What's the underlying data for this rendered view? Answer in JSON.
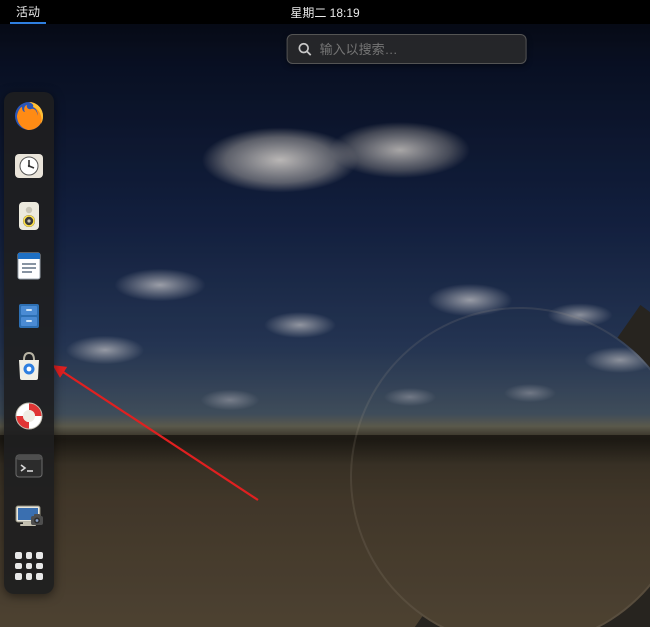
{
  "topbar": {
    "activities_label": "活动",
    "clock": "星期二 18:19"
  },
  "search": {
    "placeholder": "输入以搜索…"
  },
  "dock": {
    "items": [
      {
        "name": "firefox"
      },
      {
        "name": "clock"
      },
      {
        "name": "rhythmbox"
      },
      {
        "name": "libreoffice-writer"
      },
      {
        "name": "files"
      },
      {
        "name": "software"
      },
      {
        "name": "help"
      },
      {
        "name": "terminal"
      },
      {
        "name": "screenshot"
      },
      {
        "name": "show-applications"
      }
    ]
  },
  "annotation": {
    "arrow_color": "#e02020",
    "target": "software"
  }
}
